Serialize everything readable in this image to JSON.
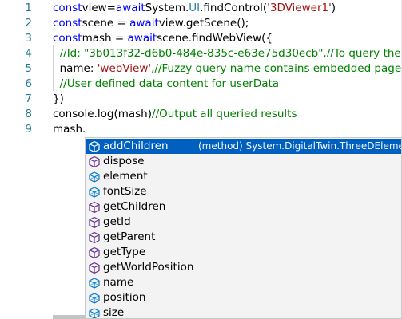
{
  "editor": {
    "lines": [
      {
        "n": "1",
        "parts": [
          [
            "kw",
            "const"
          ],
          [
            "",
            "view="
          ],
          [
            "kw",
            "await"
          ],
          [
            "",
            "System."
          ],
          [
            "type",
            "UI"
          ],
          [
            "",
            ".findControl("
          ],
          [
            "str",
            "'3DViewer1'"
          ],
          [
            "",
            ")"
          ]
        ]
      },
      {
        "n": "2",
        "parts": [
          [
            "kw",
            "const"
          ],
          [
            "",
            "scene = "
          ],
          [
            "kw",
            "await"
          ],
          [
            "",
            "view.getScene();"
          ]
        ]
      },
      {
        "n": "3",
        "parts": [
          [
            "kw",
            "const"
          ],
          [
            "",
            "mash = "
          ],
          [
            "kw",
            "await"
          ],
          [
            "",
            "scene.findWebView({"
          ]
        ]
      },
      {
        "n": "4",
        "parts": [
          [
            "",
            "  "
          ],
          [
            "cmt",
            "//Id: \"3b013f32-d6b0-484e-835c-e63e75d30ecb\",//To query the un"
          ]
        ]
      },
      {
        "n": "5",
        "parts": [
          [
            "",
            "  name: "
          ],
          [
            "str",
            "'webView'"
          ],
          [
            "",
            ","
          ],
          [
            "cmt",
            "//Fuzzy query name contains embedded pages o"
          ]
        ]
      },
      {
        "n": "6",
        "parts": [
          [
            "",
            "  "
          ],
          [
            "cmt",
            "//User defined data content for userData"
          ]
        ]
      },
      {
        "n": "7",
        "parts": [
          [
            "",
            "})"
          ]
        ]
      },
      {
        "n": "8",
        "parts": [
          [
            "",
            "console.log(mash)"
          ],
          [
            "cmt",
            "//Output all queried results"
          ]
        ]
      },
      {
        "n": "9",
        "parts": [
          [
            "",
            "mash."
          ]
        ]
      }
    ]
  },
  "suggest": {
    "selected_detail": "(method) System.DigitalTwin.ThreeDElement.a",
    "items": [
      {
        "label": "addChildren",
        "icon": "method-cube-icon"
      },
      {
        "label": "dispose",
        "icon": "method-cube-icon"
      },
      {
        "label": "element",
        "icon": "field-icon"
      },
      {
        "label": "fontSize",
        "icon": "field-icon"
      },
      {
        "label": "getChildren",
        "icon": "method-cube-icon"
      },
      {
        "label": "getId",
        "icon": "method-cube-icon"
      },
      {
        "label": "getParent",
        "icon": "method-cube-icon"
      },
      {
        "label": "getType",
        "icon": "method-cube-icon"
      },
      {
        "label": "getWorldPosition",
        "icon": "method-cube-icon"
      },
      {
        "label": "name",
        "icon": "field-icon"
      },
      {
        "label": "position",
        "icon": "field-icon"
      },
      {
        "label": "size",
        "icon": "field-icon"
      }
    ]
  },
  "colors": {
    "method_icon": "#652d90",
    "method_icon_selected": "#ffffff",
    "field_icon": "#007acc"
  }
}
